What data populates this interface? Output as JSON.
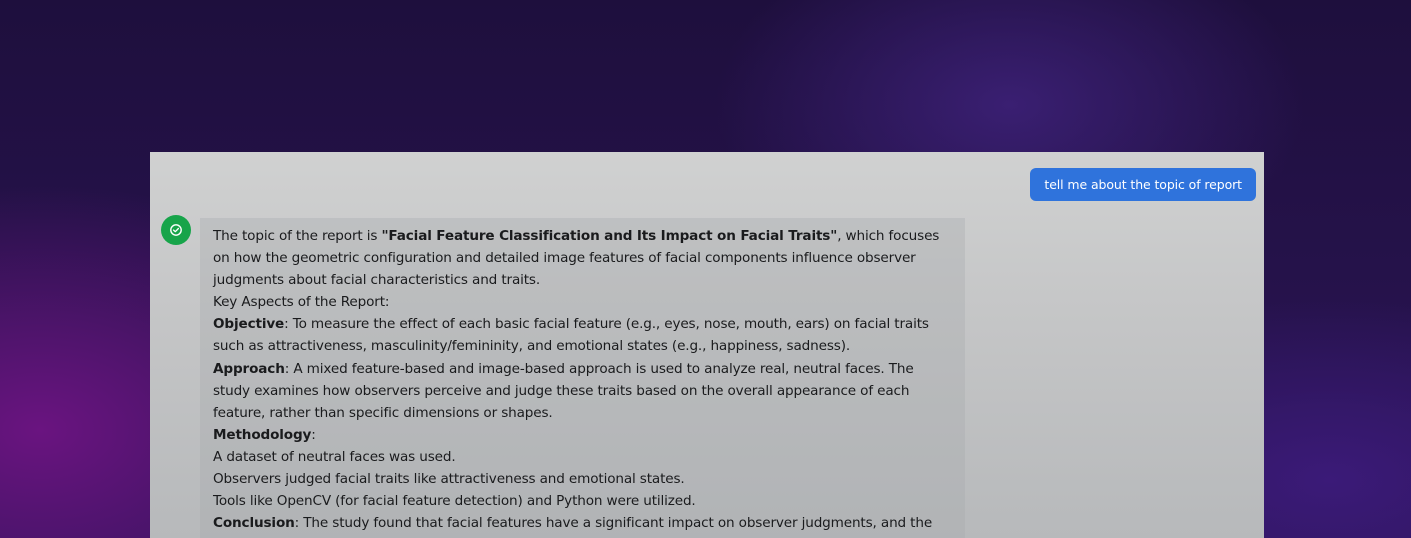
{
  "chat": {
    "user_message": "tell me about the topic of report",
    "bot_avatar_icon": "check-circle-icon",
    "response": {
      "intro_prefix": "The topic of the report is ",
      "report_title": "\"Facial Feature Classification and Its Impact on Facial Traits\"",
      "intro_suffix": ", which focuses on how the geometric configuration and detailed image features of facial components influence observer judgments about facial characteristics and traits.",
      "key_aspects_heading": "Key Aspects of the Report:",
      "objective_label": "Objective",
      "objective_text": ": To measure the effect of each basic facial feature (e.g., eyes, nose, mouth, ears) on facial traits such as attractiveness, masculinity/femininity, and emotional states (e.g., happiness, sadness).",
      "approach_label": "Approach",
      "approach_text": ": A mixed feature-based and image-based approach is used to analyze real, neutral faces. The study examines how observers perceive and judge these traits based on the overall appearance of each feature, rather than specific dimensions or shapes.",
      "methodology_label": "Methodology",
      "methodology_text": ":",
      "methodology_points": [
        "A dataset of neutral faces was used.",
        "Observers judged facial traits like attractiveness and emotional states.",
        "Tools like OpenCV (for facial feature detection) and Python were utilized."
      ],
      "conclusion_label": "Conclusion",
      "conclusion_text": ": The study found that facial features have a significant impact on observer judgments, and the"
    }
  },
  "colors": {
    "user_bubble": "#2f73dc",
    "avatar": "#17a44a"
  }
}
